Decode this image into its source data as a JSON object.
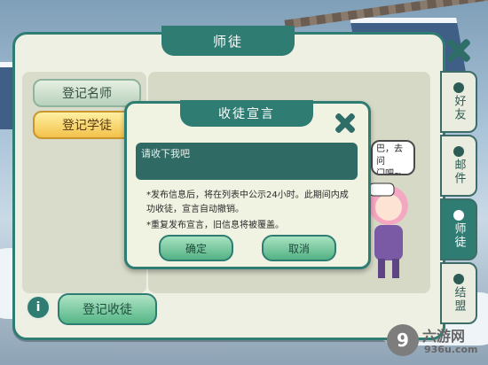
{
  "panel": {
    "title": "师徒"
  },
  "sidebar_left": {
    "items": [
      {
        "label": "登记名师"
      },
      {
        "label": "登记学徒"
      }
    ]
  },
  "tabs": [
    {
      "label": "好友"
    },
    {
      "label": "邮件"
    },
    {
      "label": "师徒"
    },
    {
      "label": "结盟"
    }
  ],
  "bottom": {
    "register_label": "登记收徒",
    "info_glyph": "i"
  },
  "speech_bubble": {
    "text": "巴，去问\n门吧~"
  },
  "dialog": {
    "title": "收徒宣言",
    "input_value": "请收下我吧",
    "note1": "*发布信息后，将在列表中公示24小时。此期间内成功收徒，宣言自动撤销。",
    "note2": "*重复发布宣言，旧信息将被覆盖。",
    "confirm_label": "确定",
    "cancel_label": "取消"
  },
  "watermark": {
    "glyph": "9",
    "cn": "六游网",
    "en": "936u.com"
  },
  "colors": {
    "accent": "#2f7c73",
    "highlight": "#f2c24a"
  }
}
